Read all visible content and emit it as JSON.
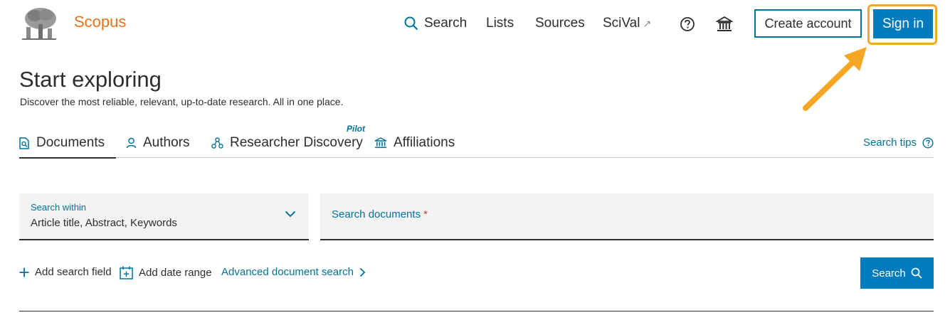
{
  "header": {
    "brand": "Scopus",
    "nav": {
      "search": "Search",
      "lists": "Lists",
      "sources": "Sources",
      "scival": "SciVal",
      "scival_ext_glyph": "↗"
    },
    "create_account": "Create account",
    "sign_in": "Sign in"
  },
  "hero": {
    "title": "Start exploring",
    "subtitle": "Discover the most reliable, relevant, up-to-date research. All in one place."
  },
  "tabs": [
    {
      "label": "Documents",
      "icon": "document-search-icon",
      "active": true
    },
    {
      "label": "Authors",
      "icon": "person-icon"
    },
    {
      "label": "Researcher Discovery",
      "icon": "network-icon",
      "badge": "Pilot"
    },
    {
      "label": "Affiliations",
      "icon": "institution-icon"
    }
  ],
  "search_tips": "Search tips",
  "search_within": {
    "label": "Search within",
    "value": "Article title, Abstract, Keywords"
  },
  "search_documents": {
    "label": "Search documents",
    "required_mark": "*"
  },
  "actions": {
    "add_search_field": "Add search field",
    "add_date_range": "Add date range",
    "advanced_search": "Advanced document search"
  },
  "search_button": "Search",
  "colors": {
    "brand_orange": "#e9711c",
    "link_blue": "#007398",
    "primary_button": "#007bbd",
    "highlight": "#f5a623",
    "field_bg": "#f3f3f3"
  }
}
